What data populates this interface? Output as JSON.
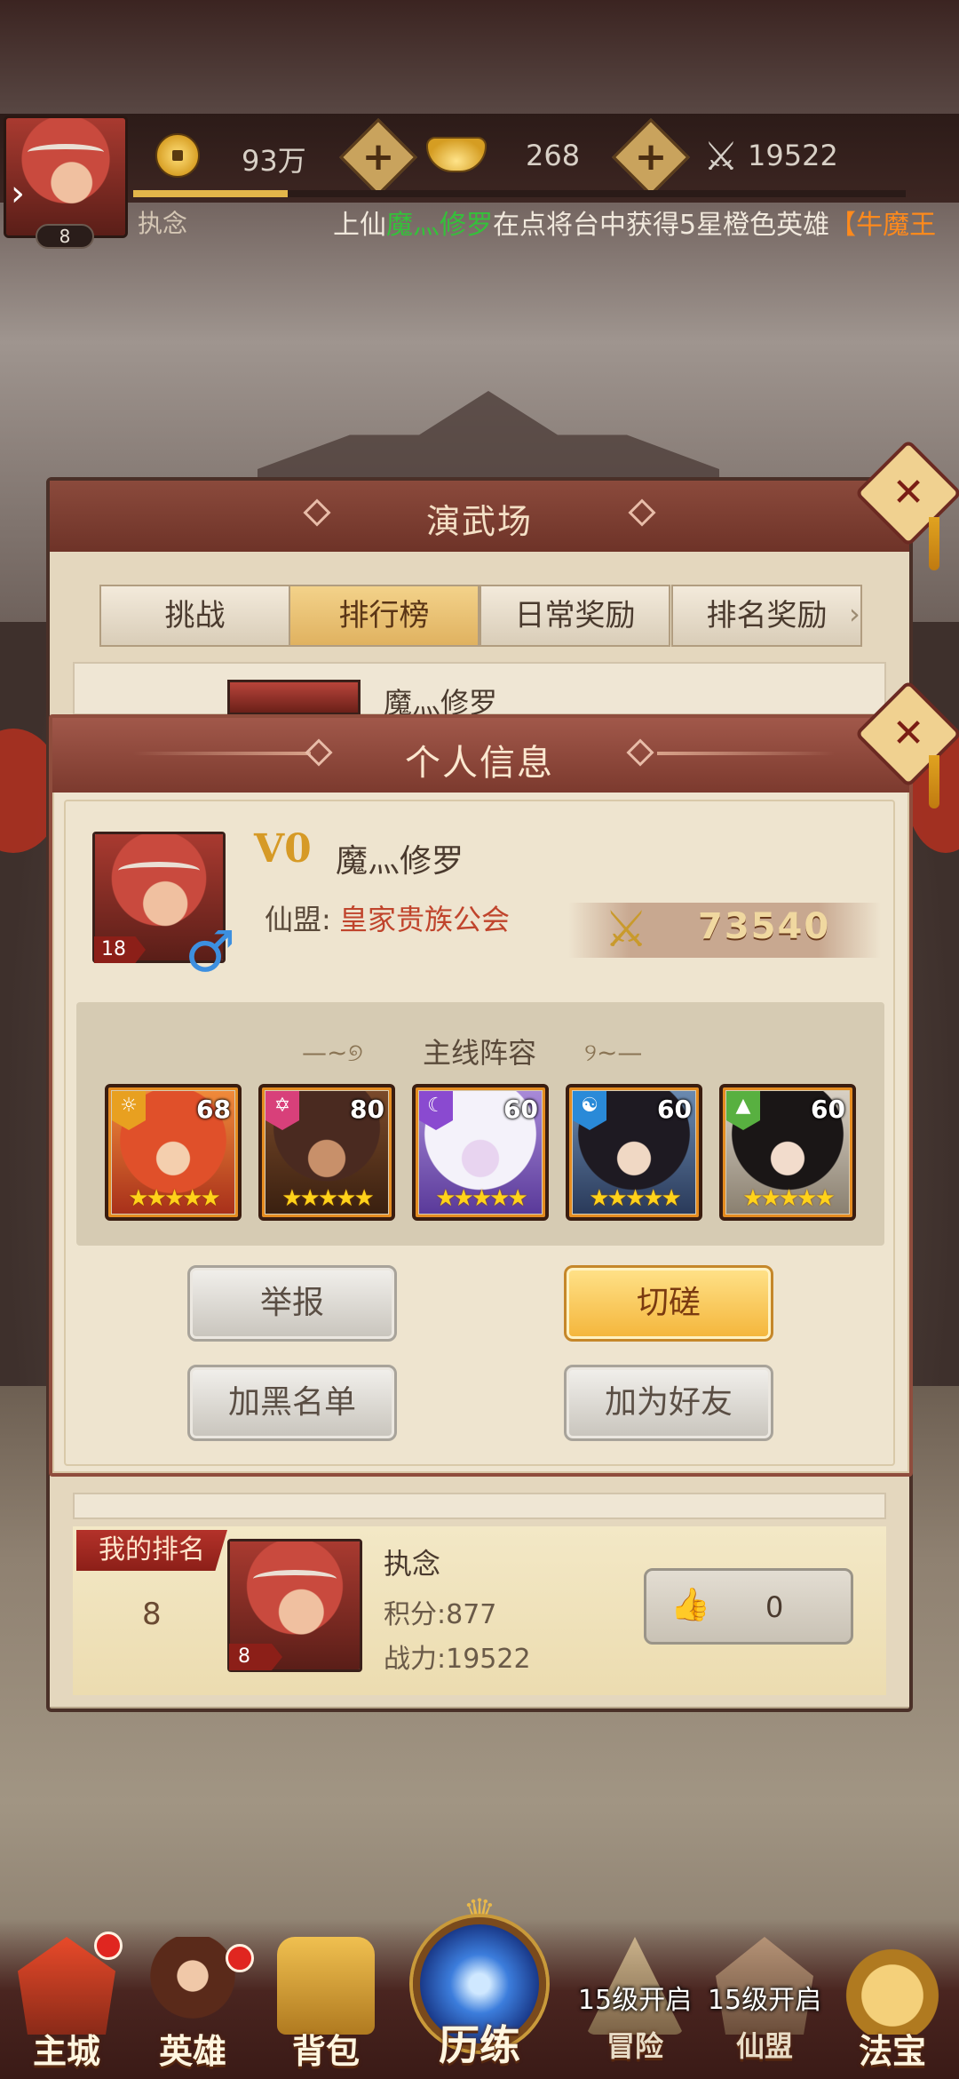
{
  "hud": {
    "player_level": "8",
    "coins": "93万",
    "ingots": "268",
    "power": "19522",
    "player_name": "执念",
    "xp_fraction": 0.2,
    "marquee": {
      "prefix": "上仙",
      "user": "魔灬修罗",
      "middle": "在点将台中获得5星橙色英雄",
      "hero_open": "【",
      "hero": "牛魔王"
    }
  },
  "arena": {
    "title": "演武场",
    "tabs": [
      "挑战",
      "排行榜",
      "日常奖励",
      "排名奖励"
    ],
    "active_tab": 1,
    "top_row_name": "魔灬修罗",
    "my_rank": {
      "label": "我的排名",
      "rank": "8",
      "name": "执念",
      "level": "8",
      "score": "积分:877",
      "power": "战力:19522",
      "likes": "0"
    }
  },
  "dialog": {
    "title": "个人信息",
    "vip": "V0",
    "name": "魔灬修罗",
    "level": "18",
    "gender": "♂",
    "guild_label": "仙盟:",
    "guild_name": "皇家贵族公会",
    "power": "73540",
    "lineup_title": "主线阵容",
    "heroes": [
      {
        "level": "68",
        "faction_icon": "sun-icon",
        "faction_color": "#e8a020",
        "stars": "★★★★★"
      },
      {
        "level": "80",
        "faction_icon": "hexagram-icon",
        "faction_color": "#d8407a",
        "stars": "★★★★★"
      },
      {
        "level": "60",
        "faction_icon": "moon-icon",
        "faction_color": "#8a4ad0",
        "stars": "★★★★★"
      },
      {
        "level": "60",
        "faction_icon": "taiji-icon",
        "faction_color": "#2a8ad8",
        "stars": "★★★★★"
      },
      {
        "level": "60",
        "faction_icon": "mountain-icon",
        "faction_color": "#58b040",
        "stars": "★★★★★"
      }
    ],
    "buttons": {
      "report": "举报",
      "duel": "切磋",
      "blacklist": "加黑名单",
      "add_friend": "加为好友"
    }
  },
  "bottom_nav": {
    "items": [
      {
        "label": "主城",
        "icon": "main-city-icon",
        "badge": true
      },
      {
        "label": "英雄",
        "icon": "hero-icon",
        "badge": true
      },
      {
        "label": "背包",
        "icon": "bag-icon",
        "badge": false
      },
      {
        "label": "历练",
        "icon": "training-orb-icon",
        "badge": false
      },
      {
        "label": "冒险",
        "icon": "adventure-icon",
        "badge": false,
        "lock": "15级开启"
      },
      {
        "label": "仙盟",
        "icon": "guild-icon",
        "badge": false,
        "lock": "15级开启"
      },
      {
        "label": "法宝",
        "icon": "treasure-icon",
        "badge": false
      }
    ]
  },
  "colors": {
    "accent_gold": "#f4b53a",
    "header_red": "#8b4a3c",
    "guild_red": "#c0442c",
    "marquee_green": "#34c13a",
    "marquee_orange": "#ff8a1c"
  }
}
